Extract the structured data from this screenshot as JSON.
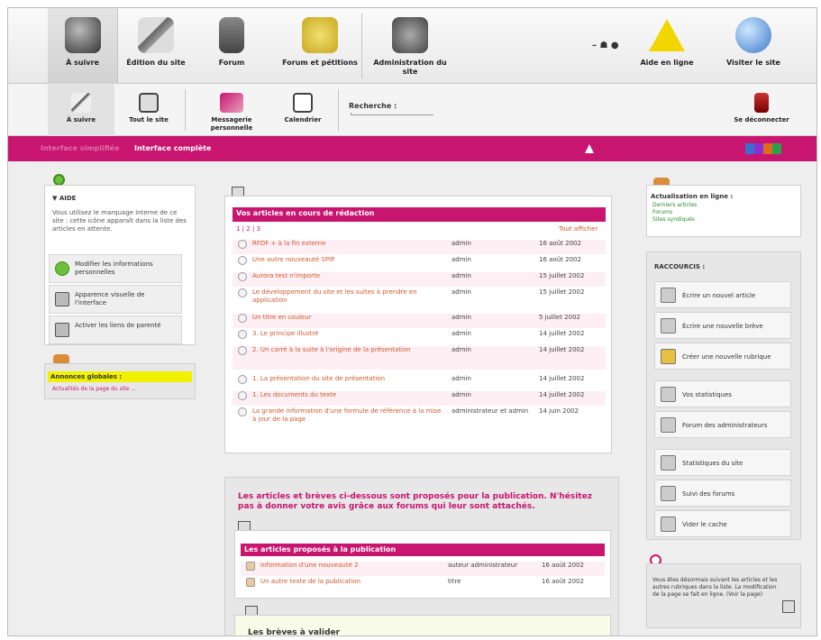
{
  "toolbar1": {
    "items": [
      {
        "label": "À suivre"
      },
      {
        "label": "Édition du site"
      },
      {
        "label": "Forum"
      },
      {
        "label": "Forum et pétitions"
      },
      {
        "label": "Administration du site"
      }
    ],
    "right": [
      {
        "label": "Aide en ligne"
      },
      {
        "label": "Visiter le site"
      }
    ]
  },
  "toolbar2": {
    "items": [
      {
        "label": "À suivre"
      },
      {
        "label": "Tout le site"
      },
      {
        "label": "Messagerie personnelle"
      },
      {
        "label": "Calendrier"
      }
    ],
    "search_label": "Recherche :",
    "logout_label": "Se déconnecter"
  },
  "pinkbar": {
    "interface_simplifiee": "Interface simplifiée",
    "interface_complete": "Interface complète"
  },
  "left": {
    "info_title": "▼ AIDE",
    "info_text": "Vous utilisez le marquage interne de ce site : cette icône apparaît dans la liste des articles en attente.",
    "buttons": [
      "Modifier les informations personnelles",
      "Apparence visuelle de l'interface",
      "Activer les liens de parenté"
    ],
    "annonces_title": "Annonces globales :",
    "annonces_sub": "Actualités de la page du site ..."
  },
  "center": {
    "articles_header": "Vos articles en cours de rédaction",
    "pagination": "1 | 2 | 3",
    "tout_afficher": "Tout afficher",
    "articles": [
      {
        "title": "RFDF + à la fin externe",
        "author": "admin",
        "date": "16 août 2002"
      },
      {
        "title": "Une autre nouveauté SPIP",
        "author": "admin",
        "date": "16 août 2002"
      },
      {
        "title": "Aurora test n'importe",
        "author": "admin",
        "date": "15 juillet 2002"
      },
      {
        "title": "Le développement du site et les suites à prendre en application",
        "author": "admin",
        "date": "15 juillet 2002"
      },
      {
        "title": "Un titre en couleur",
        "author": "admin",
        "date": "5 juillet 2002"
      },
      {
        "title": "3. Le principe illustré",
        "author": "admin",
        "date": "14 juillet 2002"
      },
      {
        "title": "2. Un carré à la suite à l'origine de la présentation",
        "author": "admin",
        "date": "14 juillet 2002"
      },
      {
        "title": "1. La présentation du site de présentation",
        "author": "admin",
        "date": "14 juillet 2002"
      },
      {
        "title": "1. Les documents du texte",
        "author": "admin",
        "date": "14 juillet 2002"
      },
      {
        "title": "La grande information d'une formule de référence à la mise à jour de la page",
        "author": "administrateur et admin",
        "date": "14 juin 2002"
      }
    ],
    "proposes_intro": "Les articles et brèves ci-dessous sont proposés pour la publication. N'hésitez pas à donner votre avis grâce aux forums qui leur sont attachés.",
    "proposes_header": "Les articles proposés à la publication",
    "proposes": [
      {
        "title": "Information d'une nouveauté 2",
        "author": "auteur administrateur",
        "date": "16 août 2002"
      },
      {
        "title": "Un autre texte de la publication",
        "author": "titre",
        "date": "16 août 2002"
      }
    ],
    "breves_title": "Les brèves à valider"
  },
  "right": {
    "actu_title": "Actualisation en ligne :",
    "actu_links": [
      "Derniers articles",
      "Forums",
      "Sites syndiqués"
    ],
    "raccourcis_title": "RACCOURCIS :",
    "buttons": [
      "Écrire un nouvel article",
      "Écrire une nouvelle brève",
      "Créer une nouvelle rubrique",
      "Vos statistiques",
      "Forum des administrateurs",
      "Statistiques du site",
      "Suivi des forums",
      "Vider le cache"
    ],
    "note": "Vous êtes désormais suivant les articles et les autres rubriques dans la liste. La modification de la page se fait en ligne. (Voir la page)"
  }
}
